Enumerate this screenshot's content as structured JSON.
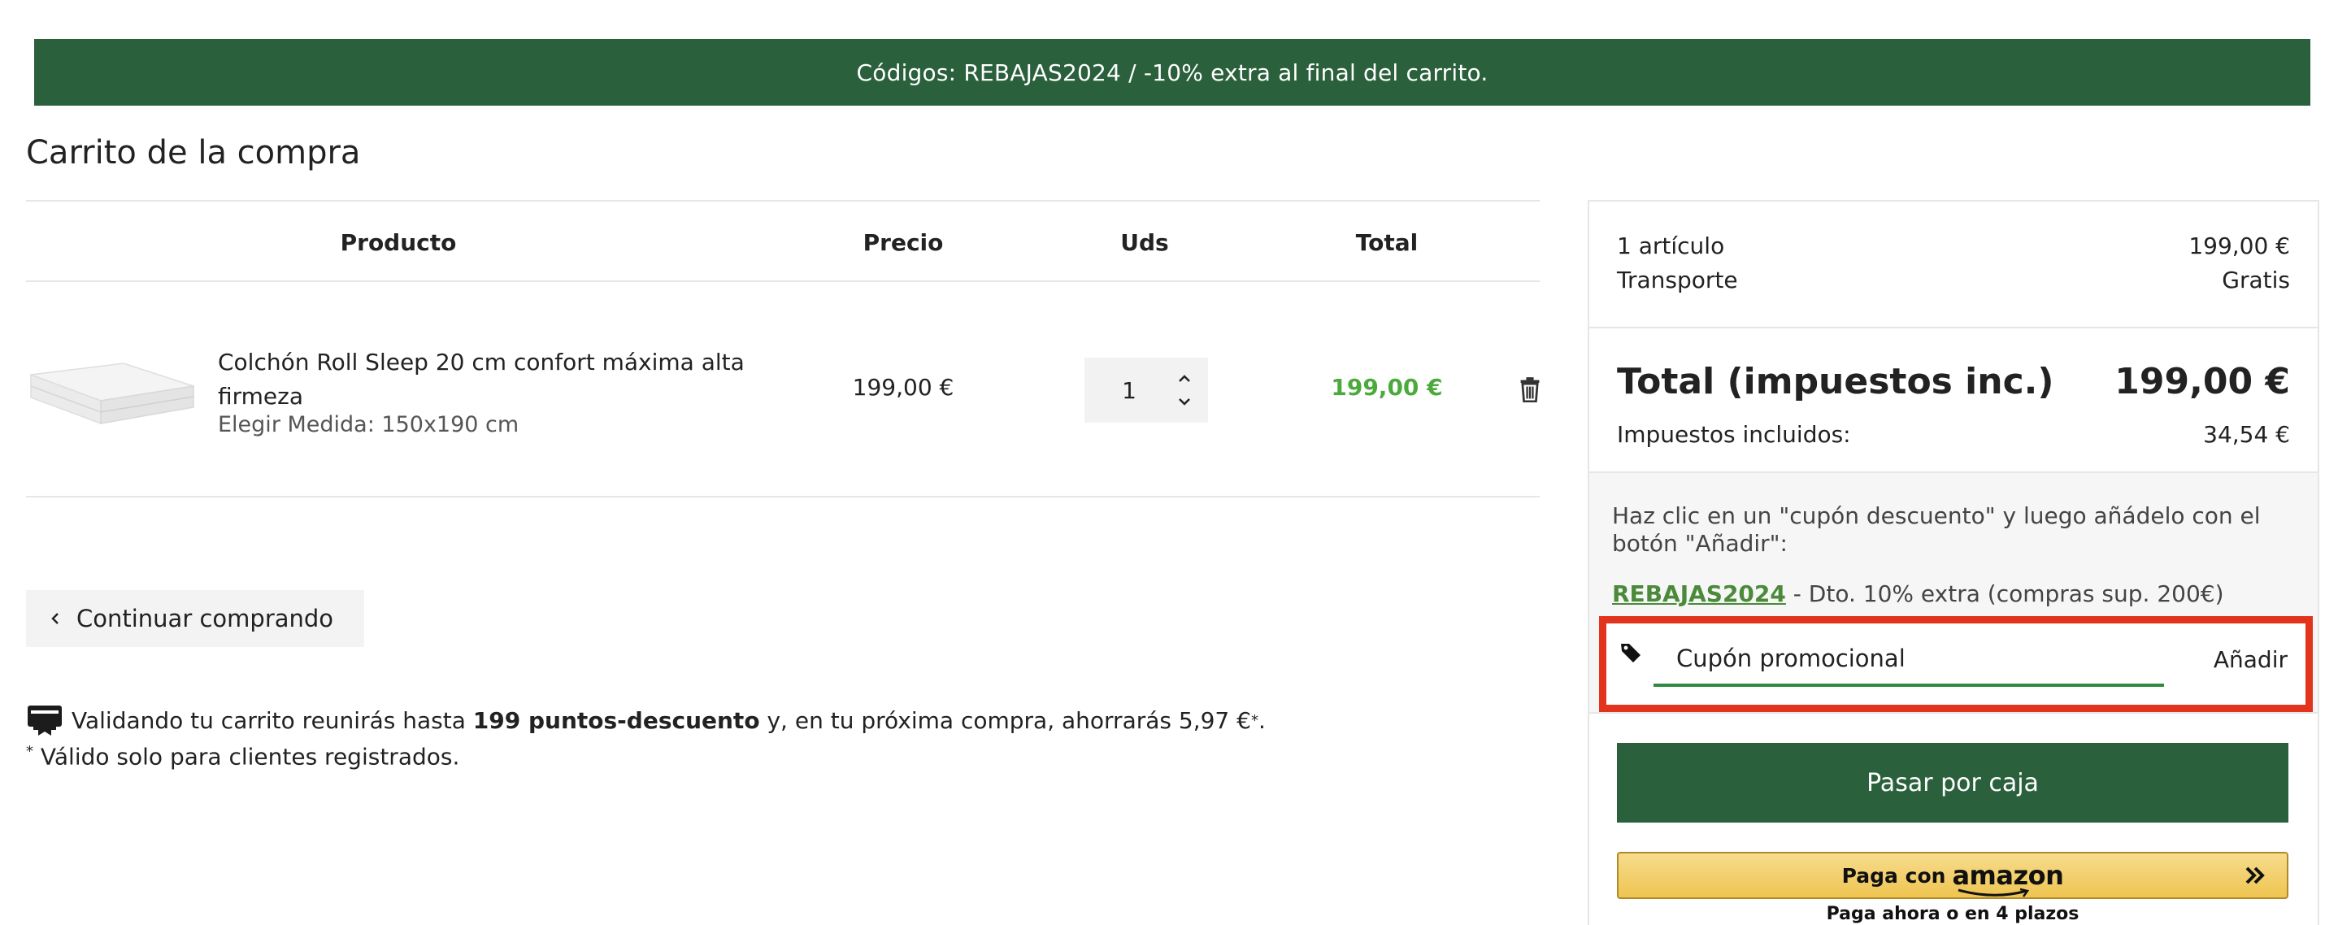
{
  "banner": {
    "text": "Códigos: REBAJAS2024 / -10% extra al final del carrito."
  },
  "page": {
    "title": "Carrito de la compra"
  },
  "table": {
    "headers": {
      "product": "Producto",
      "price": "Precio",
      "qty": "Uds",
      "total": "Total"
    },
    "rows": [
      {
        "name": "Colchón Roll Sleep 20 cm confort máxima alta firmeza",
        "variant": "Elegir Medida: 150x190 cm",
        "price": "199,00 €",
        "qty": "1",
        "total": "199,00 €"
      }
    ]
  },
  "continue_shopping": {
    "label": "Continuar comprando"
  },
  "points": {
    "prefix": "Validando tu carrito reunirás hasta",
    "bold": "199 puntos-descuento",
    "suffix": "y, en tu próxima compra, ahorrarás 5,97 €",
    "note": "Válido solo para clientes registrados."
  },
  "summary": {
    "items_label": "1 artículo",
    "items_value": "199,00 €",
    "shipping_label": "Transporte",
    "shipping_value": "Gratis",
    "total_label": "Total (impuestos inc.)",
    "total_value": "199,00 €",
    "tax_label": "Impuestos incluidos:",
    "tax_value": "34,54 €"
  },
  "coupon": {
    "hint": "Haz clic en un \"cupón descuento\" y luego añádelo con el botón \"Añadir\":",
    "code": "REBAJAS2024",
    "description": "- Dto. 10% extra (compras sup. 200€)",
    "placeholder": "Cupón promocional",
    "add_label": "Añadir"
  },
  "checkout": {
    "label": "Pasar por caja"
  },
  "amazon_pay": {
    "prefix": "Paga con",
    "brand": "amazon",
    "note": "Paga ahora o en 4 plazos"
  },
  "colors": {
    "brand_green": "#2a603c",
    "price_green": "#4caa3c",
    "highlight_red": "#e2331c"
  }
}
